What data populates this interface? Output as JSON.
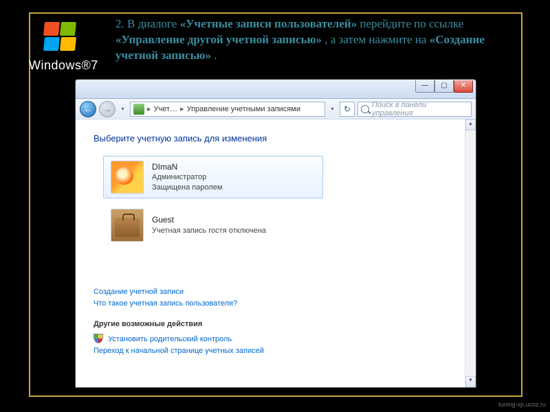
{
  "background": {
    "logo_text": "Windows®7"
  },
  "instruction": {
    "prefix": "2. В диалоге ",
    "b1": "«Учетные записи пользователей»",
    "mid1": " перейдите по ссылке ",
    "b2": "«Управление другой учетной записью»",
    "mid2": ", а затем нажмите на ",
    "b3": "«Создание учетной записью»",
    "suffix": "."
  },
  "dialog": {
    "breadcrumb": {
      "crumb1": "Учет…",
      "crumb2": "Управление учетными записями",
      "sep": "▸"
    },
    "search_placeholder": "Поиск в панели управления",
    "heading": "Выберите учетную запись для изменения",
    "accounts": [
      {
        "name": "DImaN",
        "line2": "Администратор",
        "line3": "Защищена паролем",
        "avatar": "flower",
        "selected": true
      },
      {
        "name": "Guest",
        "line2": "Учетная запись гостя отключена",
        "line3": "",
        "avatar": "suitcase",
        "selected": false
      }
    ],
    "link_create": "Создание учетной записи",
    "link_whatis": "Что такое учетная запись пользователя?",
    "other_heading": "Другие возможные действия",
    "link_parental": "Установить родительский контроль",
    "link_gohome": "Переход к начальной странице учетных записей"
  },
  "watermark": "tuning-xp.ucoz.ru",
  "glyphs": {
    "back": "←",
    "fwd": "→",
    "dd": "▾",
    "up": "▲",
    "down": "▼",
    "refresh": "↻",
    "min": "—",
    "max": "▢",
    "close": "✕"
  }
}
